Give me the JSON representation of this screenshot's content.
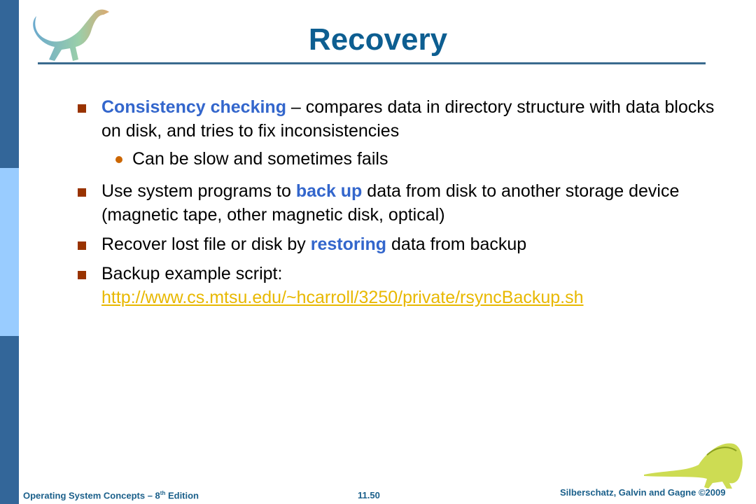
{
  "slide": {
    "title": "Recovery",
    "bullets": [
      {
        "highlight": "Consistency checking",
        "text_after": " – compares data in directory structure with data blocks on disk, and tries to fix inconsistencies",
        "sub": "Can be slow and sometimes fails"
      },
      {
        "text_before": "Use system programs to ",
        "highlight": "back up",
        "text_after": " data from disk to another storage device (magnetic tape, other magnetic disk, optical)"
      },
      {
        "text_before": "Recover lost file or disk by ",
        "highlight": "restoring",
        "text_after": " data from backup"
      },
      {
        "text_before": "Backup example script:",
        "link": "http://www.cs.mtsu.edu/~hcarroll/3250/private/rsyncBackup.sh"
      }
    ]
  },
  "footer": {
    "book": "Operating System Concepts  – 8",
    "book_sup": "th",
    "book_after": " Edition",
    "page": "11.50",
    "copyright": "Silberschatz, Galvin and Gagne ©2009"
  },
  "colors": {
    "sidebar_dark": "#336699",
    "sidebar_light": "#99ccff",
    "title": "#0d5e91",
    "highlight": "#3366cc",
    "bullet_square": "#993300",
    "bullet_dot": "#cc6600",
    "link": "#e8b800"
  }
}
